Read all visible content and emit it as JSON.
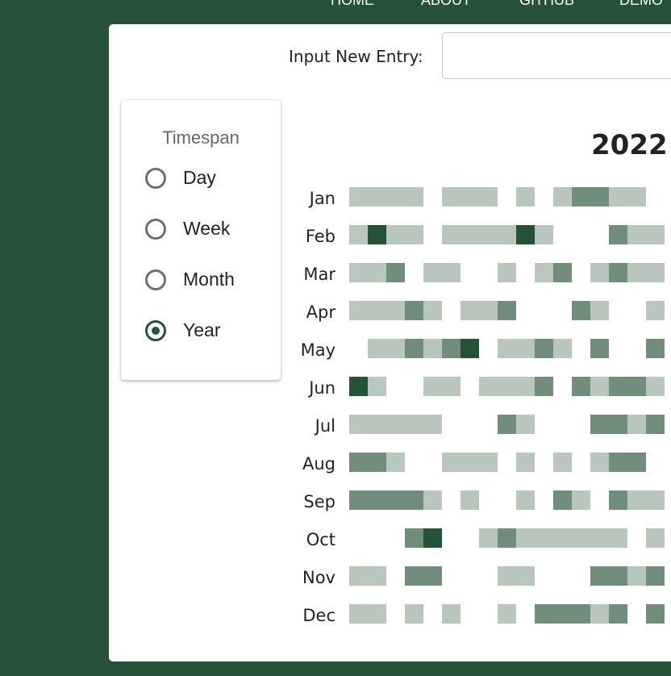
{
  "nav": [
    "HOME",
    "ABOUT",
    "GITHUB",
    "DEMO"
  ],
  "entry": {
    "label": "Input New Entry:",
    "value": "",
    "placeholder": ""
  },
  "timespan": {
    "title": "Timespan",
    "options": [
      "Day",
      "Week",
      "Month",
      "Year"
    ],
    "selected": "Year"
  },
  "calendar": {
    "year": "2022",
    "colors": [
      "#ffffff",
      "#b9c6bd",
      "#718d7b",
      "#265237"
    ],
    "months": [
      "Jan",
      "Feb",
      "Mar",
      "Apr",
      "May",
      "Jun",
      "Jul",
      "Aug",
      "Sep",
      "Oct",
      "Nov",
      "Dec"
    ],
    "levels": [
      [
        1,
        1,
        1,
        1,
        0,
        1,
        1,
        1,
        0,
        1,
        0,
        1,
        2,
        2,
        1,
        1,
        0
      ],
      [
        1,
        3,
        1,
        1,
        0,
        1,
        1,
        1,
        1,
        3,
        1,
        0,
        0,
        0,
        2,
        1,
        1
      ],
      [
        1,
        1,
        2,
        0,
        1,
        1,
        0,
        0,
        1,
        0,
        1,
        2,
        0,
        1,
        2,
        1,
        1
      ],
      [
        1,
        1,
        1,
        2,
        1,
        0,
        1,
        1,
        2,
        0,
        0,
        0,
        2,
        1,
        0,
        0,
        1
      ],
      [
        0,
        1,
        1,
        2,
        1,
        2,
        3,
        0,
        1,
        1,
        2,
        1,
        0,
        2,
        0,
        0,
        2
      ],
      [
        3,
        1,
        0,
        0,
        1,
        1,
        0,
        1,
        1,
        1,
        2,
        0,
        2,
        1,
        2,
        2,
        1
      ],
      [
        1,
        1,
        1,
        1,
        1,
        0,
        0,
        0,
        2,
        1,
        0,
        0,
        0,
        2,
        2,
        1,
        2
      ],
      [
        2,
        2,
        1,
        0,
        0,
        1,
        1,
        1,
        0,
        1,
        0,
        1,
        0,
        1,
        2,
        2,
        0
      ],
      [
        2,
        2,
        2,
        2,
        1,
        0,
        1,
        0,
        0,
        1,
        0,
        2,
        1,
        0,
        2,
        1,
        1
      ],
      [
        0,
        0,
        0,
        2,
        3,
        0,
        0,
        1,
        2,
        1,
        1,
        1,
        1,
        1,
        1,
        0,
        1
      ],
      [
        1,
        1,
        0,
        2,
        2,
        0,
        0,
        0,
        1,
        1,
        0,
        0,
        0,
        2,
        2,
        1,
        2
      ],
      [
        1,
        1,
        0,
        1,
        0,
        1,
        0,
        0,
        1,
        0,
        2,
        2,
        2,
        1,
        2,
        0,
        2
      ]
    ]
  }
}
